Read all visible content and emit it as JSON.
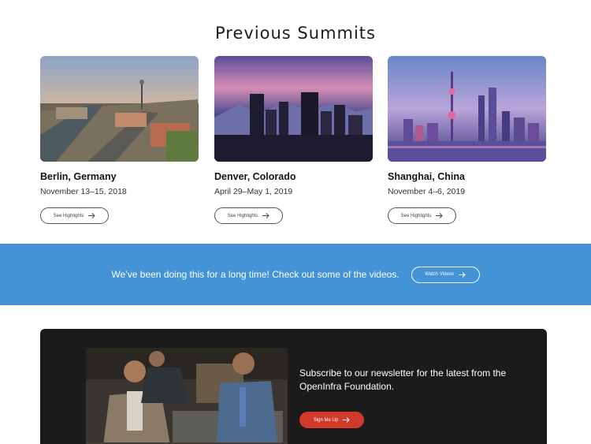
{
  "section": {
    "title": "Previous Summits"
  },
  "summits": [
    {
      "city": "Berlin, Germany",
      "date": "November 13–15, 2018",
      "button": "See Highlights"
    },
    {
      "city": "Denver, Colorado",
      "date": "April 29–May 1, 2019",
      "button": "See Highlights"
    },
    {
      "city": "Shanghai, China",
      "date": "November 4–6, 2019",
      "button": "See Highlights"
    }
  ],
  "banner": {
    "text": "We’ve been doing this for a long time! Check out some of the videos.",
    "button": "Watch Videos",
    "color": "#4393d6"
  },
  "newsletter": {
    "text": "Subscribe to our newsletter for the latest from the OpenInfra Foundation.",
    "button": "Sign Me Up",
    "button_color": "#d13a2b",
    "background": "#1b1b1b"
  },
  "icons": {
    "button_arrow": "arrow-right-icon"
  }
}
